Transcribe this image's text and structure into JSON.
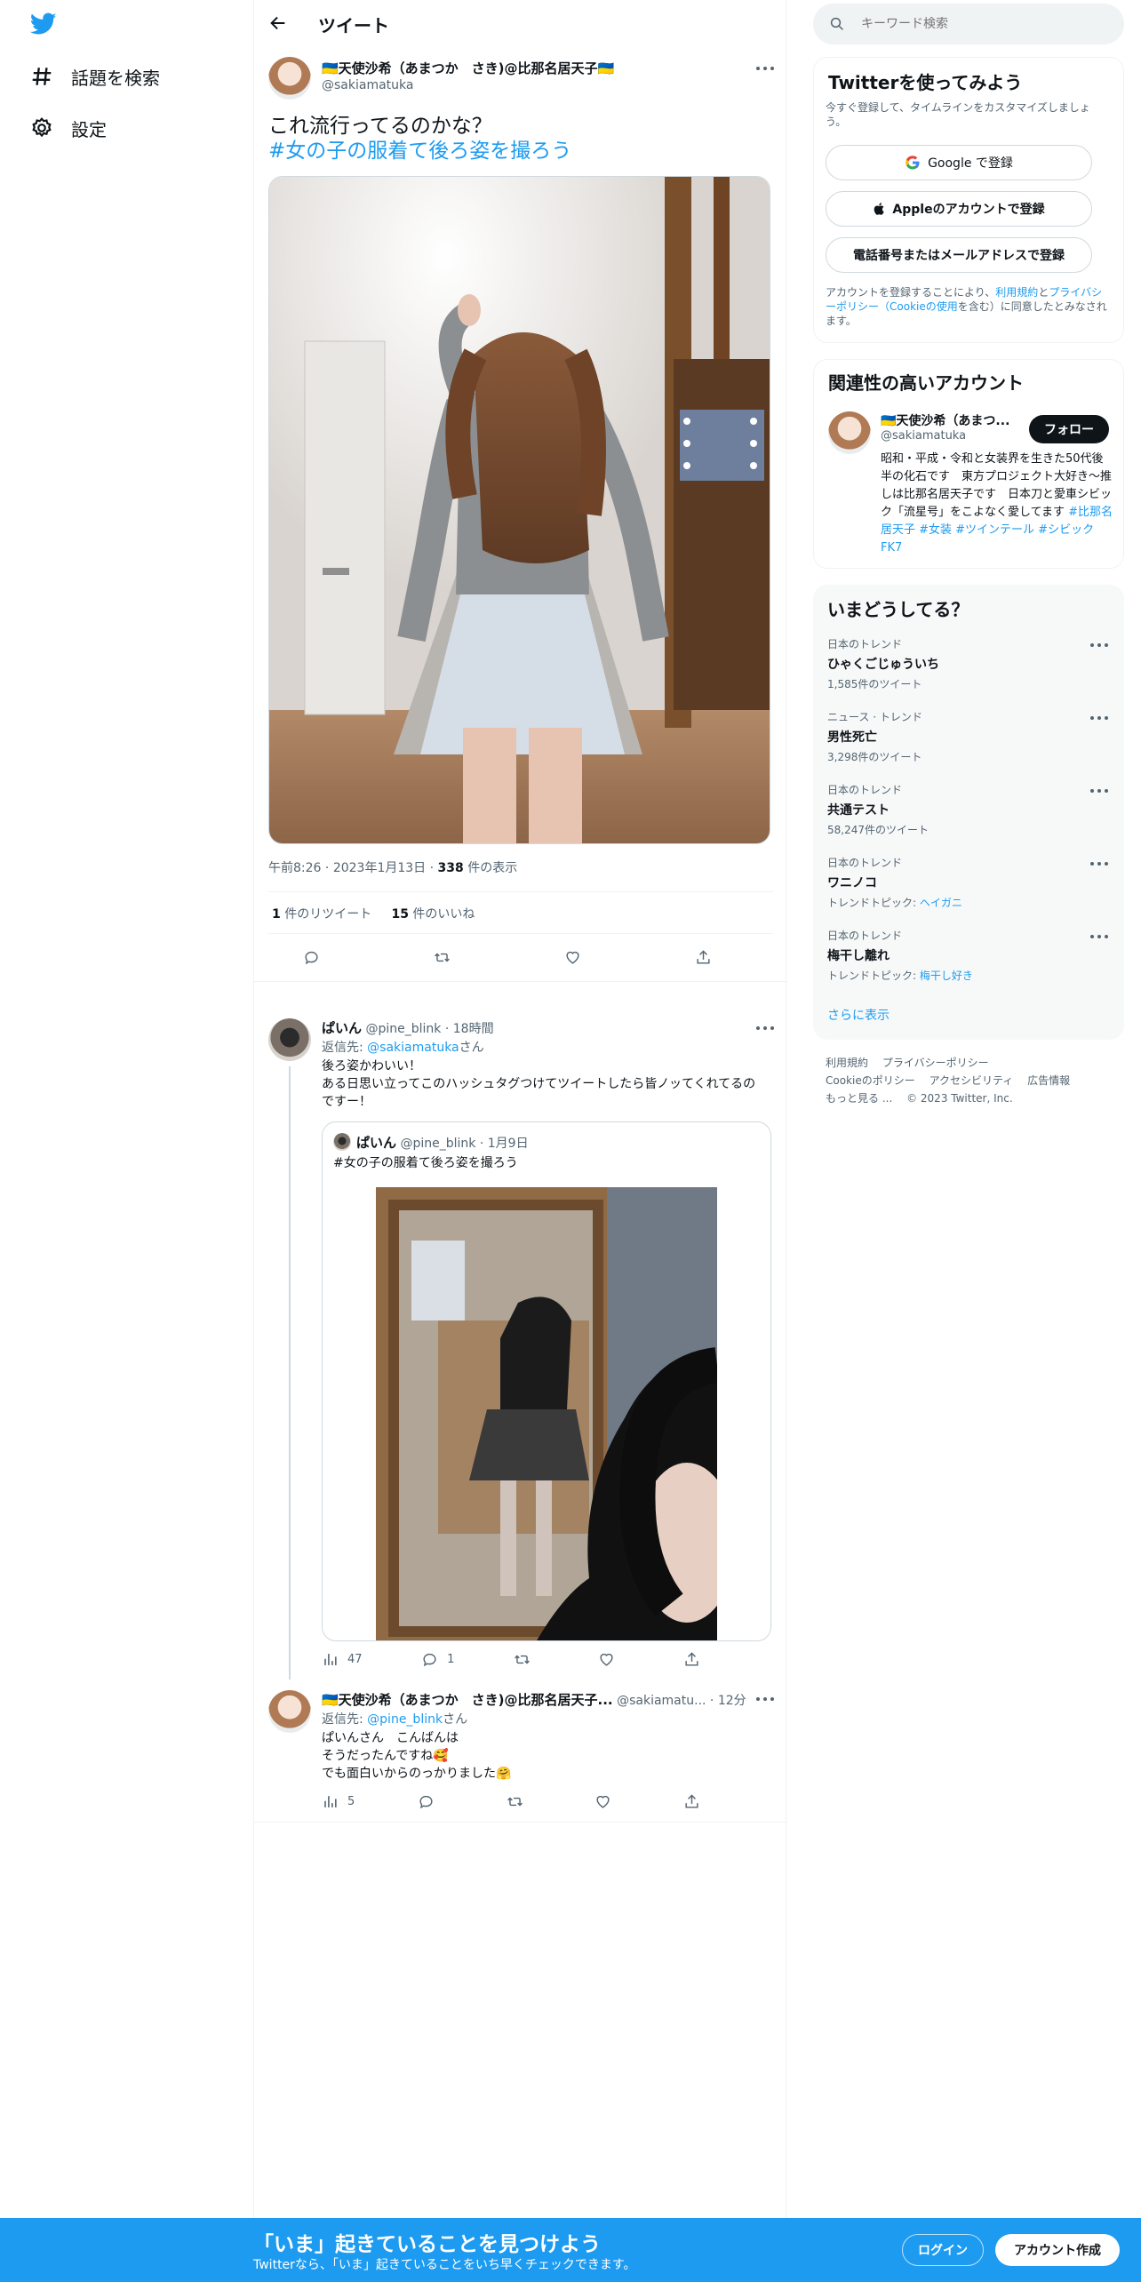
{
  "nav": {
    "explore_label": "話題を検索",
    "settings_label": "設定"
  },
  "header": {
    "title": "ツイート"
  },
  "main_tweet": {
    "display_name": "🇺🇦天使沙希（あまつか　さき)@比那名居天子🇺🇦",
    "handle": "@sakiamatuka",
    "text": "これ流行ってるのかな？",
    "hashtag": " #女の子の服着て後ろ姿を撮ろう",
    "time": "午前8:26",
    "date": "2023年1月13日",
    "views_count": "338",
    "views_label": " 件の表示",
    "retweet_count": "1",
    "retweet_label": " 件のリツイート",
    "like_count": "15",
    "like_label": " 件のいいね"
  },
  "reply1": {
    "display_name": "ぱいん",
    "handle": "@pine_blink",
    "time": "18時間",
    "reply_to_prefix": "返信先: ",
    "reply_to_handle": "@sakiamatuka",
    "reply_to_suffix": "さん",
    "text_line1": "後ろ姿かわいい！",
    "text_line2": "ある日思い立ってこのハッシュタグつけてツイートしたら皆ノッてくれてるのですー！",
    "views": "47",
    "replies": "1",
    "quote": {
      "display_name": "ぱいん",
      "handle": "@pine_blink",
      "time": "1月9日",
      "text": "#女の子の服着て後ろ姿を撮ろう"
    }
  },
  "reply2": {
    "display_name": "🇺🇦天使沙希（あまつか　さき)@比那名居天子...",
    "handle": "@sakiamatu...",
    "time": "12分",
    "reply_to_prefix": "返信先: ",
    "reply_to_handle": "@pine_blink",
    "reply_to_suffix": "さん",
    "text_line1": "ぱいんさん　こんばんは",
    "text_line2": "そうだったんですね🥰",
    "text_line3": "でも面白いからのっかりました🤗",
    "views": "5"
  },
  "search": {
    "placeholder": "キーワード検索"
  },
  "signup_card": {
    "title": "Twitterを使ってみよう",
    "subtitle": "今すぐ登録して、タイムラインをカスタマイズしましょう。",
    "google_label": "Google で登録",
    "apple_label": "Appleのアカウントで登録",
    "phone_label": "電話番号またはメールアドレスで登録",
    "terms_prefix": "アカウントを登録することにより、",
    "terms_link": "利用規約",
    "terms_and": "と",
    "privacy_link": "プライバシーポリシー（Cookieの使用",
    "terms_suffix": "を含む）に同意したとみなされます。"
  },
  "related_card": {
    "title": "関連性の高いアカウント",
    "display_name": "🇺🇦天使沙希（あまつ...",
    "handle": "@sakiamatuka",
    "follow_label": "フォロー",
    "bio": "昭和・平成・令和と女装界を生きた50代後半の化石です　東方プロジェクト大好き～推しは比那名居天子です　日本刀と愛車シビック「流星号」をこよなく愛してます ",
    "bio_tags": "#比那名居天子 #女装 #ツインテール #シビックFK7"
  },
  "trends_card": {
    "title": "いまどうしてる？",
    "items": [
      {
        "category": "日本のトレンド",
        "name": "ひゃくごじゅういち",
        "meta": "1,585件のツイート",
        "meta_link": ""
      },
      {
        "category": "ニュース · トレンド",
        "name": "男性死亡",
        "meta": "3,298件のツイート",
        "meta_link": ""
      },
      {
        "category": "日本のトレンド",
        "name": "共通テスト",
        "meta": "58,247件のツイート",
        "meta_link": ""
      },
      {
        "category": "日本のトレンド",
        "name": "ワニノコ",
        "meta": "トレンドトピック: ",
        "meta_link": "ヘイガニ"
      },
      {
        "category": "日本のトレンド",
        "name": "梅干し離れ",
        "meta": "トレンドトピック: ",
        "meta_link": "梅干し好き"
      }
    ],
    "show_more": "さらに表示"
  },
  "footer": {
    "terms": "利用規約",
    "privacy": "プライバシーポリシー",
    "cookie": "Cookieのポリシー",
    "accessibility": "アクセシビリティ",
    "ads": "広告情報",
    "more": "もっと見る ...",
    "copyright": "© 2023 Twitter, Inc."
  },
  "bottom_bar": {
    "title": "「いま」起きていることを見つけよう",
    "subtitle": "Twitterなら、「いま」起きていることをいち早くチェックできます。",
    "login_label": "ログイン",
    "signup_label": "アカウント作成"
  },
  "colors": {
    "brand": "#1d9bf0",
    "text": "#0f1419",
    "secondary_text": "#536471",
    "border": "#eff3f4"
  }
}
